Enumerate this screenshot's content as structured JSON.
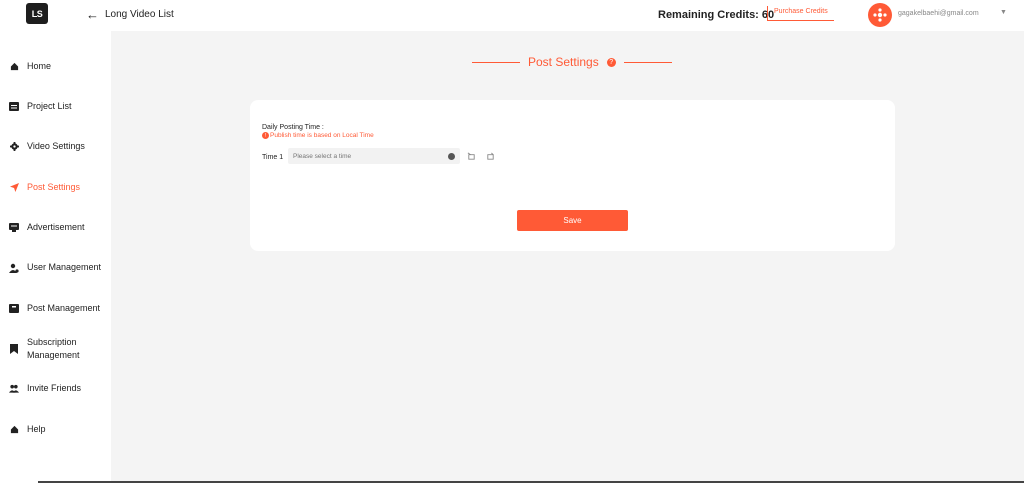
{
  "header": {
    "logo_text": "LS",
    "back_label": "Long Video List",
    "credits_label": "Remaining Credits: 60",
    "purchase_label": "Purchase Credits",
    "email": "gagakelbaehi@gmail.com"
  },
  "sidebar": {
    "items": [
      {
        "label": "Home",
        "icon": "home-icon"
      },
      {
        "label": "Project List",
        "icon": "list-icon"
      },
      {
        "label": "Video Settings",
        "icon": "gear-icon"
      },
      {
        "label": "Post Settings",
        "icon": "send-icon",
        "active": true
      },
      {
        "label": "Advertisement",
        "icon": "ad-icon"
      },
      {
        "label": "User Management",
        "icon": "user-gear-icon"
      },
      {
        "label": "Post Management",
        "icon": "inbox-icon"
      },
      {
        "label": "Subscription Management",
        "icon": "bookmark-icon"
      },
      {
        "label": "Invite Friends",
        "icon": "users-icon"
      },
      {
        "label": "Help",
        "icon": "help-home-icon"
      }
    ]
  },
  "main": {
    "title": "Post Settings",
    "help_glyph": "?",
    "daily_label": "Daily Posting Time :",
    "note": "Publish time is based on Local Time",
    "note_glyph": "!",
    "time_label": "Time 1",
    "time_placeholder": "Please select a time",
    "save_label": "Save"
  },
  "colors": {
    "accent": "#ff5a36",
    "background": "#f4f4f4",
    "card": "#ffffff"
  }
}
